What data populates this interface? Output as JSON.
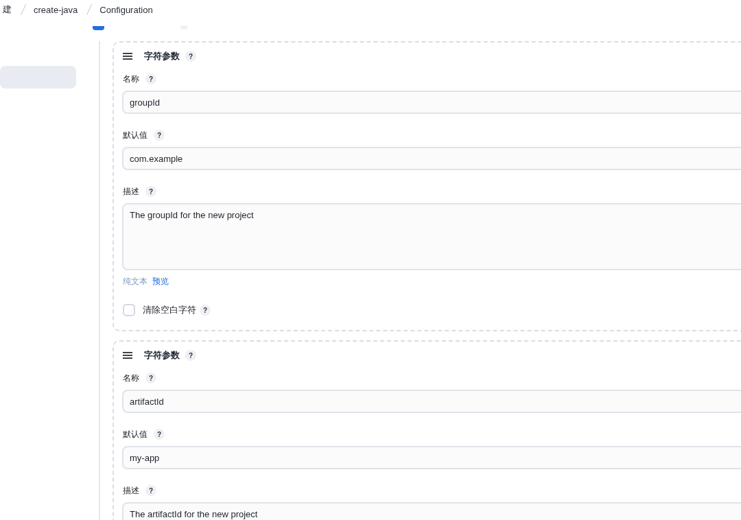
{
  "breadcrumbs": [
    {
      "label": "建"
    },
    {
      "label": "create-java"
    },
    {
      "label": "Configuration"
    }
  ],
  "partial_row": {
    "checkbox": {
      "checked": true
    }
  },
  "sidebar": {
    "items": [
      {
        "selected": true
      }
    ]
  },
  "parameters": [
    {
      "title": "字符参数",
      "title_help": "?",
      "fields": [
        {
          "kind": "input",
          "label": "名称",
          "help": "?",
          "value": "groupId"
        },
        {
          "kind": "input",
          "label": "默认值",
          "help": "?",
          "value": "com.example"
        },
        {
          "kind": "textarea",
          "label": "描述",
          "help": "?",
          "value": "The groupId for the new project",
          "format_links": [
            {
              "kind": "current",
              "label": "纯文本"
            },
            {
              "kind": "link",
              "label": "预览"
            }
          ]
        }
      ],
      "trim": {
        "label": "清除空白字符",
        "help": "?",
        "checked": false
      }
    },
    {
      "title": "字符参数",
      "title_help": "?",
      "fields": [
        {
          "kind": "input",
          "label": "名称",
          "help": "?",
          "value": "artifactId"
        },
        {
          "kind": "input",
          "label": "默认值",
          "help": "?",
          "value": "my-app"
        },
        {
          "kind": "textarea",
          "label": "描述",
          "help": "?",
          "value": "The artifactId for the new project"
        }
      ]
    }
  ]
}
